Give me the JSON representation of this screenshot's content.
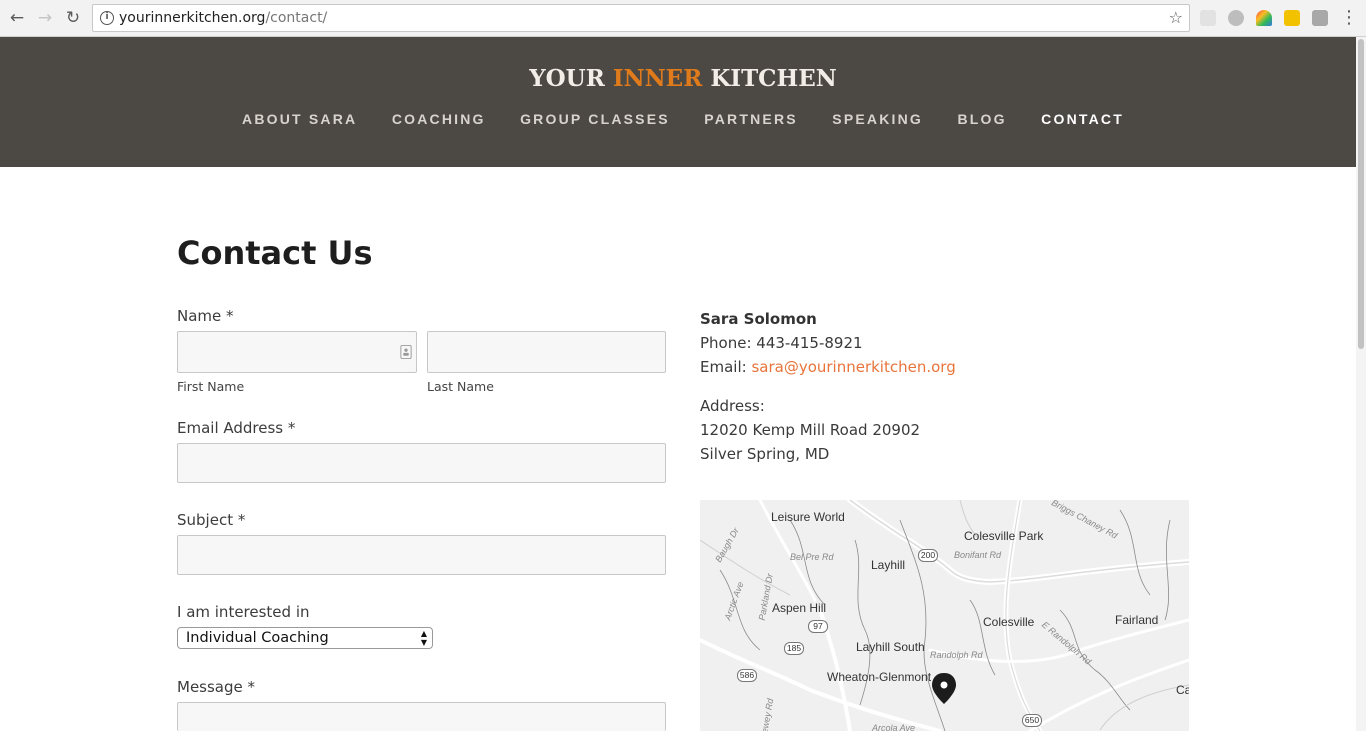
{
  "browser": {
    "url_host": "yourinnerkitchen.org",
    "url_path": "/contact/",
    "back_icon": "back-arrow-icon",
    "forward_icon": "forward-arrow-icon",
    "reload_icon": "reload-icon",
    "star_icon": "bookmark-star-icon",
    "menu_icon": "vertical-dots-icon"
  },
  "site": {
    "logo_part1": "YOUR ",
    "logo_accent": "INNER",
    "logo_part2": " KITCHEN",
    "nav": [
      {
        "label": "ABOUT SARA"
      },
      {
        "label": "COACHING"
      },
      {
        "label": "GROUP CLASSES"
      },
      {
        "label": "PARTNERS"
      },
      {
        "label": "SPEAKING"
      },
      {
        "label": "BLOG"
      },
      {
        "label": "CONTACT"
      }
    ],
    "active_nav": "CONTACT",
    "header_bg": "#4c4844",
    "accent_color": "#e07b1c"
  },
  "form": {
    "title": "Contact Us",
    "name_label": "Name *",
    "first_name_label": "First Name",
    "last_name_label": "Last Name",
    "email_label": "Email Address *",
    "subject_label": "Subject *",
    "interest_label": "I am interested in",
    "interest_selected": "Individual Coaching",
    "message_label": "Message *"
  },
  "contact": {
    "name": "Sara Solomon",
    "phone": "Phone: 443-415-8921",
    "email_prefix": "Email: ",
    "email": "sara@yourinnerkitchen.org",
    "link_color": "#e8743b",
    "address_label": "Address:",
    "address_line1": "12020 Kemp Mill Road 20902",
    "address_line2": "Silver Spring, MD"
  },
  "map": {
    "places": [
      "Leisure World",
      "Colesville Park",
      "Layhill",
      "Aspen Hill",
      "Colesville",
      "Fairland",
      "Layhill South",
      "Wheaton-Glenmont",
      "Ca"
    ],
    "roads": [
      "Bel Pre Rd",
      "Bonifant Rd",
      "Briggs Chaney Rd",
      "Randolph Rd",
      "E Randolph Rd",
      "Parkland Dr",
      "Baugh Dr",
      "Arctic Ave",
      "Arcola Ave",
      "Dewey Rd"
    ],
    "shields": [
      "200",
      "97",
      "185",
      "586",
      "650"
    ],
    "marker_icon": "map-pin-icon"
  }
}
